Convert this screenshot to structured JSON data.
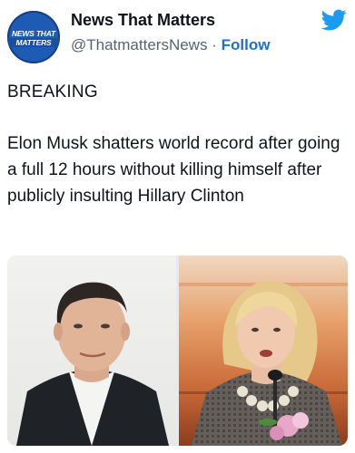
{
  "tweet": {
    "avatar": {
      "line1": "NEWS THAT",
      "line2": "MATTERS",
      "color": "#1e5bb5"
    },
    "display_name": "News That Matters",
    "handle": "@ThatmattersNews",
    "separator": "·",
    "follow_label": "Follow",
    "brand_icon": "twitter-bird-icon",
    "brand_color": "#1d9bf0",
    "breaking_label": "BREAKING",
    "headline": "Elon Musk shatters world record after going a full 12 hours without killing himself after publicly insulting Hillary Clinton",
    "photo": {
      "left_panel": "man-portrait",
      "right_panel": "woman-portrait"
    }
  }
}
